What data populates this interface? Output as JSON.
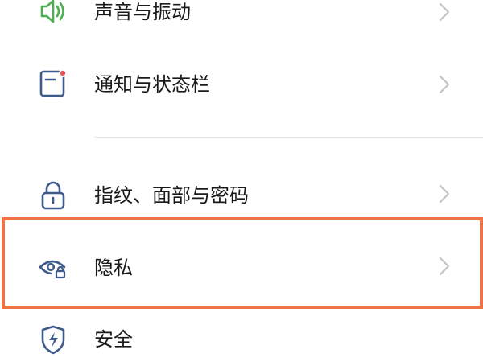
{
  "settings": {
    "items": [
      {
        "label": "声音与振动",
        "icon": "speaker-icon"
      },
      {
        "label": "通知与状态栏",
        "icon": "notification-icon"
      },
      {
        "label": "指纹、面部与密码",
        "icon": "lock-icon"
      },
      {
        "label": "隐私",
        "icon": "eye-lock-icon"
      },
      {
        "label": "安全",
        "icon": "shield-icon"
      }
    ]
  },
  "colors": {
    "sound_icon": "#4caf50",
    "notification_icon": "#3d5a8a",
    "notification_dot": "#e8555a",
    "lock_icon": "#3d5a8a",
    "privacy_icon": "#3d5a8a",
    "shield_icon": "#3d5a8a",
    "chevron": "#c4c4c4",
    "highlight": "#ee7448",
    "divider": "#e6e6e6"
  }
}
